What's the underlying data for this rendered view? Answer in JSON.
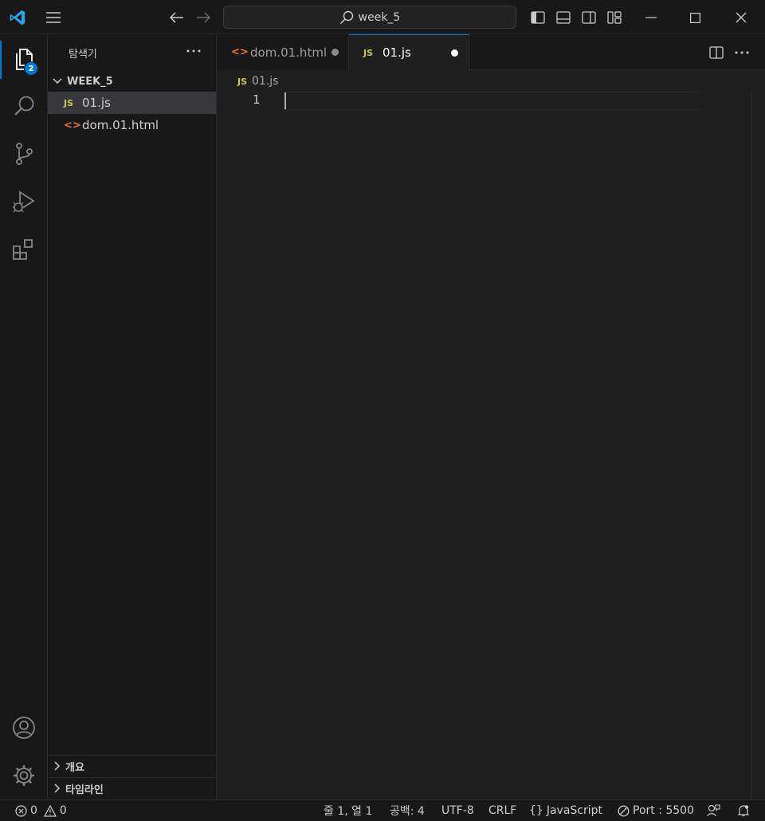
{
  "titlebar": {
    "search_text": "week_5"
  },
  "activitybar": {
    "explorer_badge": "2"
  },
  "sidebar": {
    "title": "탐색기",
    "folder_name": "WEEK_5",
    "files": [
      {
        "icon": "JS",
        "name": "01.js"
      },
      {
        "icon": "<>",
        "name": "dom.01.html"
      }
    ],
    "sections": [
      {
        "label": "개요"
      },
      {
        "label": "타임라인"
      }
    ]
  },
  "tabs": [
    {
      "icon": "<>",
      "label": "dom.01.html"
    },
    {
      "icon": "JS",
      "label": "01.js"
    }
  ],
  "breadcrumb": {
    "icon": "JS",
    "file": "01.js"
  },
  "editor": {
    "line_numbers": [
      "1"
    ]
  },
  "statusbar": {
    "errors": "0",
    "warnings": "0",
    "position": "줄 1, 열 1",
    "spaces": "공백: 4",
    "encoding": "UTF-8",
    "eol": "CRLF",
    "language_braces": "{}",
    "language": "JavaScript",
    "port": "Port : 5500"
  },
  "colors": {
    "accent": "#0078d4",
    "js_icon": "#cbcb41",
    "html_icon": "#e37933",
    "vscode_logo": "#23a9f2"
  }
}
